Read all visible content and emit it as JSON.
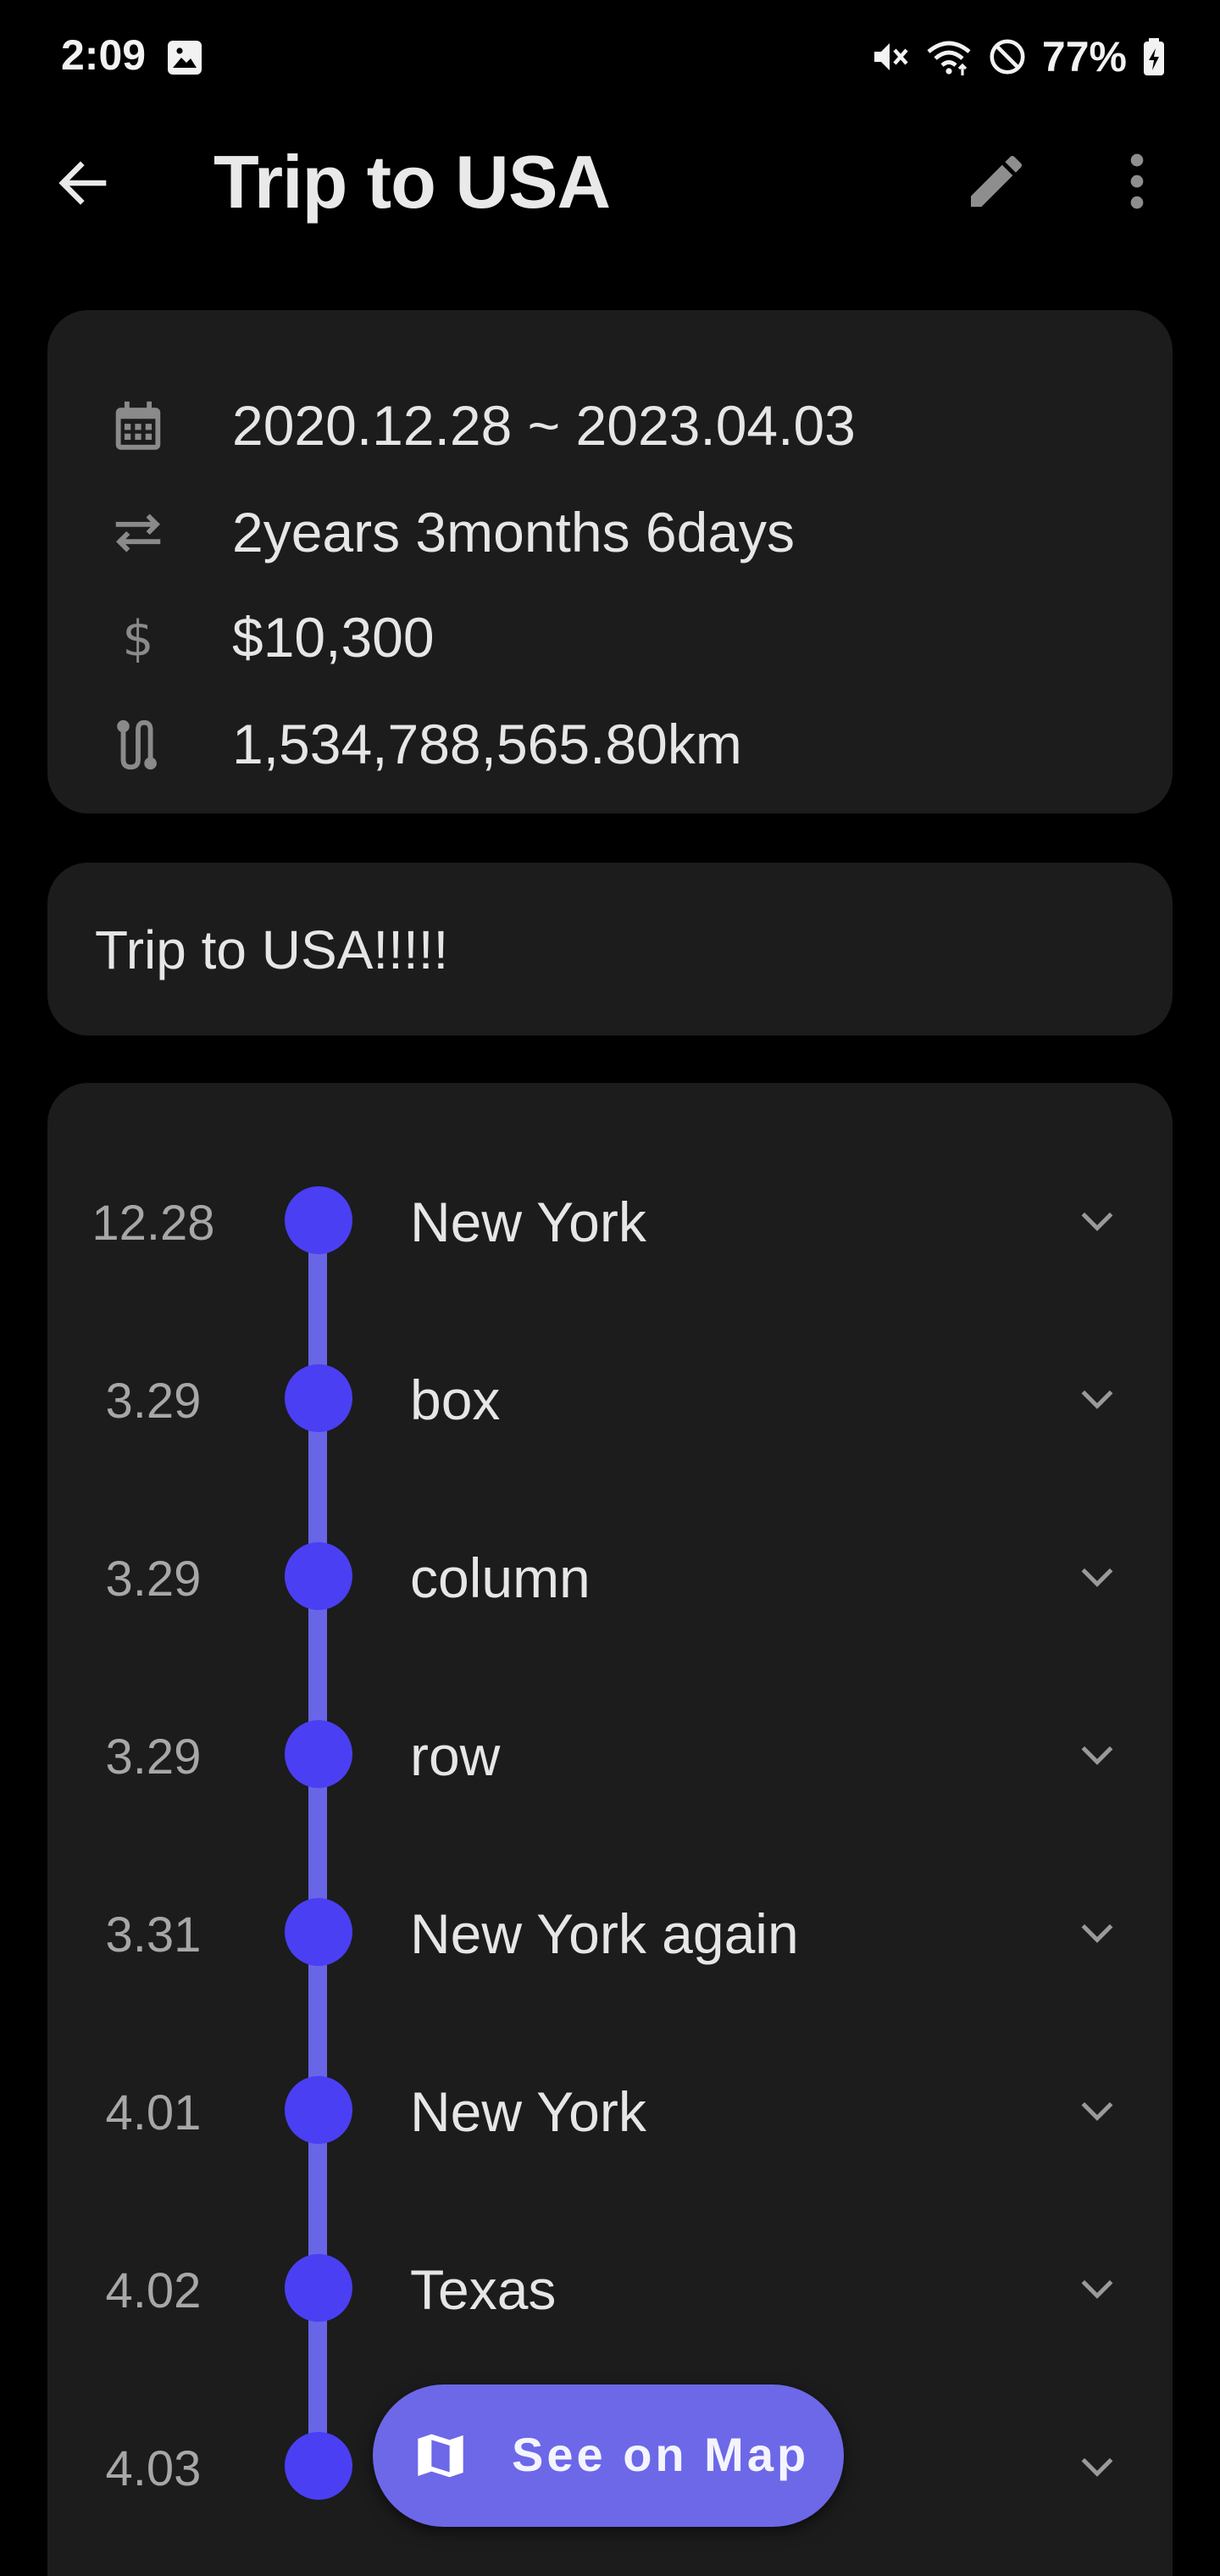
{
  "status_bar": {
    "time": "2:09",
    "battery": "77%",
    "icons": [
      "gallery-icon",
      "mute-icon",
      "wifi-icon",
      "do-not-disturb-icon",
      "battery-charging-icon"
    ]
  },
  "app_bar": {
    "title": "Trip to USA",
    "icons": [
      "back-arrow-icon",
      "edit-pencil-icon",
      "more-vert-icon"
    ]
  },
  "info": {
    "date_range": "2020.12.28 ~ 2023.04.03",
    "duration": "2years 3months 6days",
    "budget": "$10,300",
    "distance": "1,534,788,565.80km"
  },
  "memo": "Trip to USA!!!!!",
  "timeline": [
    {
      "date": "12.28",
      "name": "New York"
    },
    {
      "date": "3.29",
      "name": "box"
    },
    {
      "date": "3.29",
      "name": "column"
    },
    {
      "date": "3.29",
      "name": "row"
    },
    {
      "date": "3.31",
      "name": "New York again"
    },
    {
      "date": "4.01",
      "name": "New York"
    },
    {
      "date": "4.02",
      "name": "Texas"
    },
    {
      "date": "4.03",
      "name": ""
    }
  ],
  "fab": {
    "label": "See on Map"
  },
  "colors": {
    "background": "#000000",
    "card": "#1c1c1c",
    "accent_dot": "#4a3ff3",
    "timeline_line": "#6865e6",
    "fab": "#6c68e8"
  }
}
